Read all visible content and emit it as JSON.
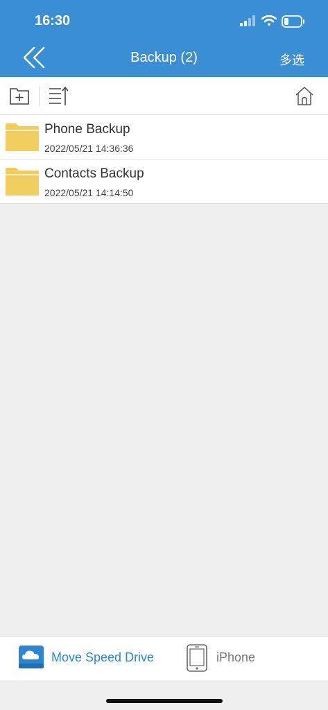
{
  "status_bar": {
    "time": "16:30",
    "icons": [
      "signal-icon",
      "wifi-icon",
      "battery-icon"
    ]
  },
  "nav": {
    "back_icon": "double-chevron-left-icon",
    "title": "Backup (2)",
    "multi_select": "多选"
  },
  "toolbar": {
    "icons": [
      "new-folder-icon",
      "sort-icon",
      "home-icon"
    ]
  },
  "files": [
    {
      "name": "Phone Backup",
      "date": "2022/05/21 14:36:36",
      "icon": "folder-icon"
    },
    {
      "name": "Contacts Backup",
      "date": "2022/05/21 14:14:50",
      "icon": "folder-icon"
    }
  ],
  "bottom_tabs": [
    {
      "label": "Move Speed Drive",
      "icon": "cloud-drive-icon",
      "active": true
    },
    {
      "label": "iPhone",
      "icon": "phone-icon",
      "active": false
    }
  ],
  "colors": {
    "header": "#3a8fd4",
    "folder": "#f0cd5c",
    "active_tab": "#2a86d1"
  }
}
